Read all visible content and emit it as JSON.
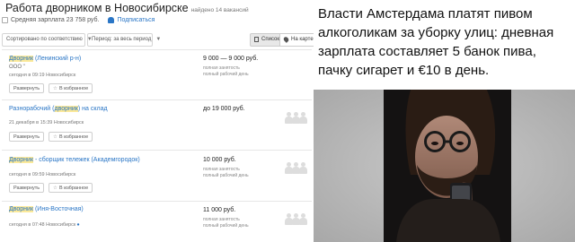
{
  "left_panel": {
    "title": "Работа дворником в Новосибирске",
    "found": "найдено 14 вакансий",
    "avg_salary": "Средняя зарплата 23 758 руб.",
    "subscribe": "Подписаться",
    "sort": "Сортировано по соответствию",
    "period": "Период: за весь период",
    "view_list": "Список",
    "view_map": "На карте",
    "vacancies": [
      {
        "title_pre": "",
        "title_hl": "Дворник",
        "title_post": " (Ленинский р-н)",
        "company": "ООО \"",
        "meta": "сегодня в 09:19   Новосибирск",
        "salary": "9 000 — 9 000 руб.",
        "employment": "полная занятость",
        "schedule": "полный рабочий день",
        "show_btn": "Развернуть",
        "fav_btn": "В избранное"
      },
      {
        "title_pre": "Разнорабочий (",
        "title_hl": "дворник",
        "title_post": ") на склад",
        "company": "",
        "meta": "21 декабря в 15:39   Новосибирск",
        "salary": "до 19 000 руб.",
        "employment": "",
        "schedule": "",
        "show_btn": "Развернуть",
        "fav_btn": "В избранное"
      },
      {
        "title_pre": "",
        "title_hl": "Дворник",
        "title_post": " - сборщик тележек (Академгородок)",
        "company": "",
        "meta": "сегодня в 09:59   Новосибирск",
        "salary": "10 000 руб.",
        "employment": "полная занятость",
        "schedule": "полный рабочий день",
        "show_btn": "Развернуть",
        "fav_btn": "В избранное"
      },
      {
        "title_pre": "",
        "title_hl": "Дворник",
        "title_post": " (Иня-Восточная)",
        "company": "",
        "meta": "сегодня в 07:48   Новосибирск",
        "salary": "11 000 руб.",
        "employment": "полная занятость",
        "schedule": "полный рабочий день",
        "show_btn": "",
        "fav_btn": ""
      }
    ]
  },
  "right_panel": {
    "meme_text": "Власти Амстердама платят пивом алкоголикам за уборку улиц: дневная зарплата составляет 5 банок пива, пачку сигарет и €10 в день."
  },
  "colors": {
    "link": "#2a76c6",
    "highlight": "#fbe99a"
  }
}
